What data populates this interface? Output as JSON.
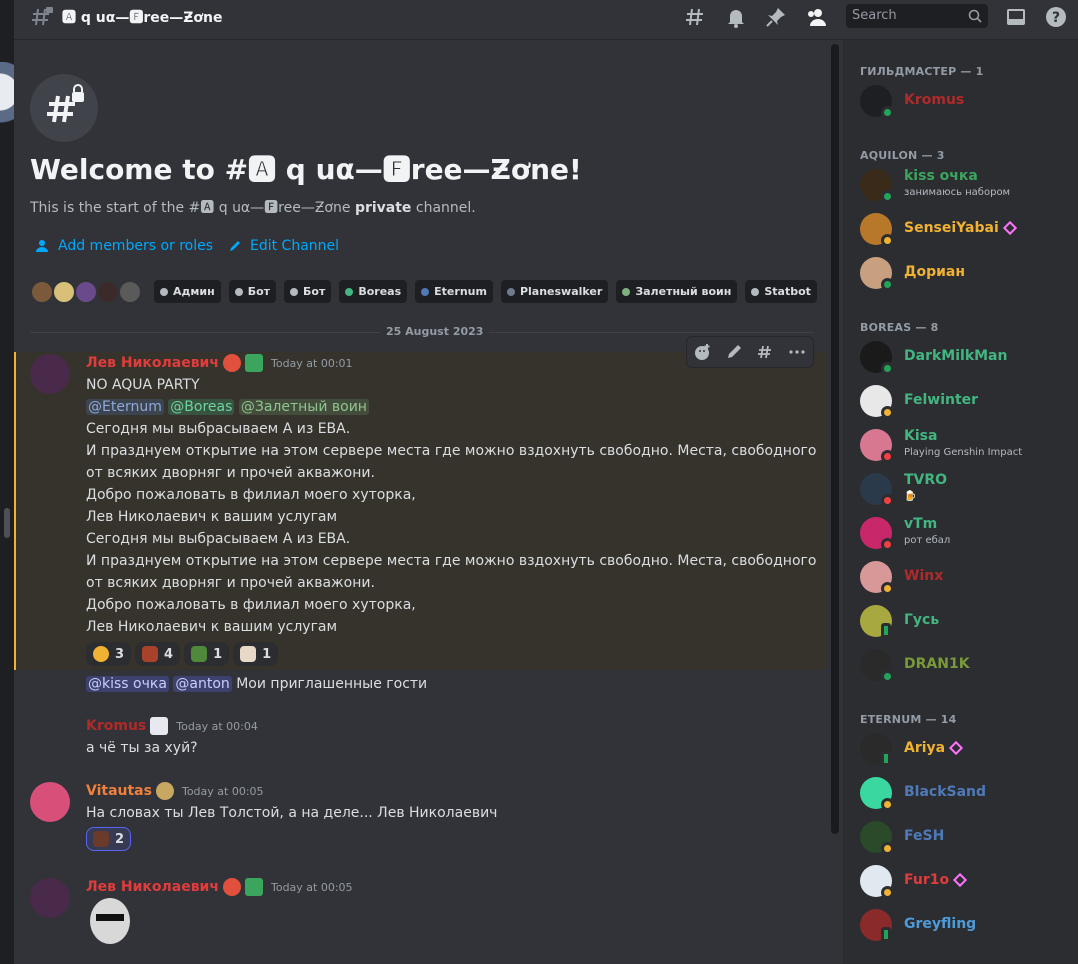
{
  "header": {
    "channel_title": "🅰 q uα—🅵ree—Ƶơne",
    "search_placeholder": "Search"
  },
  "welcome": {
    "title": "Welcome to #🅰 q uα—🅵ree—Ƶơne!",
    "sub_prefix": "This is the start of the #🅰 q uα—🅵ree—Ƶơne ",
    "sub_bold": "private",
    "sub_suffix": " channel.",
    "add_members": "Add members or roles",
    "edit_channel": "Edit Channel",
    "roles": [
      {
        "label": "Админ",
        "color": "#b5bac1"
      },
      {
        "label": "Бот",
        "color": "#b5bac1"
      },
      {
        "label": "Бот",
        "color": "#b5bac1"
      },
      {
        "label": "Boreas",
        "color": "#43b581"
      },
      {
        "label": "Eternum",
        "color": "#4f7ab8"
      },
      {
        "label": "Planeswalker",
        "color": "#6d7b8c"
      },
      {
        "label": "Залетный воин",
        "color": "#7fb27f"
      },
      {
        "label": "Statbot",
        "color": "#b5bac1"
      }
    ]
  },
  "date_divider": "25 August 2023",
  "messages": {
    "m1": {
      "author": "Лев Николаевич",
      "time": "Today at 00:01",
      "line1": "NO AQUA PARTY",
      "mention1": "@Eternum",
      "mention2": "@Boreas",
      "mention3": "@Залетный воин",
      "lines": [
        "Сегодня мы выбрасываем А из ЕВА.",
        "И празднуем открытие на этом сервере места где можно вздохнуть свободно. Места, свободного",
        "от всяких дворняг и прочей акважони.",
        "Добро пожаловать в филиал моего хуторка,",
        "Лев Николаевич к вашим услугам",
        "Сегодня мы выбрасываем А из ЕВА.",
        "И празднуем открытие на этом сервере места где можно вздохнуть свободно. Места, свободного",
        "от всяких дворняг и прочей акважони.",
        "Добро пожаловать в филиал моего хуторка,",
        "Лев Николаевич к вашим услугам"
      ],
      "reactions": [
        "3",
        "4",
        "1",
        "1"
      ]
    },
    "m2": {
      "mention1": "@kiss очка",
      "mention2": "@anton",
      "text": " Мои приглашенные гости"
    },
    "m3": {
      "author": "Kromus",
      "time": "Today at 00:04",
      "text": "а чё ты за хуй?"
    },
    "m4": {
      "author": "Vitautas",
      "time": "Today at 00:05",
      "text": "На словах ты Лев Толстой, а на деле... Лев Николаевич",
      "reaction": "2"
    },
    "m5": {
      "author": "Лев Николаевич",
      "time": "Today at 00:05"
    }
  },
  "members": {
    "groups": [
      {
        "title": "ГИЛЬДМАСТЕР — 1"
      },
      {
        "title": "AQUILON — 3"
      },
      {
        "title": "BOREAS — 8"
      },
      {
        "title": "ETERNUM — 14"
      }
    ],
    "list": [
      {
        "name": "Kromus",
        "color": "#b02a2a",
        "sub": ""
      },
      {
        "name": "kiss очка",
        "color": "#3ba55d",
        "sub": "занимаюсь набором"
      },
      {
        "name": "SenseiYabai",
        "color": "#f0b232",
        "sub": ""
      },
      {
        "name": "Дориан",
        "color": "#f0b232",
        "sub": ""
      },
      {
        "name": "DarkMilkMan",
        "color": "#43b581",
        "sub": ""
      },
      {
        "name": "Felwinter",
        "color": "#43b581",
        "sub": ""
      },
      {
        "name": "Kisa",
        "color": "#43b581",
        "sub": "Playing Genshin Impact"
      },
      {
        "name": "TVRO",
        "color": "#43b581",
        "sub": "🍺"
      },
      {
        "name": "vTm",
        "color": "#43b581",
        "sub": "рот ебал"
      },
      {
        "name": "Winx",
        "color": "#b02a2a",
        "sub": ""
      },
      {
        "name": "Гусь",
        "color": "#43b581",
        "sub": ""
      },
      {
        "name": "DRAN1K",
        "color": "#7a9a3a",
        "sub": ""
      },
      {
        "name": "Ariya",
        "color": "#f0b232",
        "sub": ""
      },
      {
        "name": "BlackSand",
        "color": "#4f7ab8",
        "sub": ""
      },
      {
        "name": "FeSH",
        "color": "#4f7ab8",
        "sub": ""
      },
      {
        "name": "Fur1o",
        "color": "#e03c3c",
        "sub": ""
      },
      {
        "name": "Greyfling",
        "color": "#4f9ad8",
        "sub": ""
      }
    ]
  }
}
